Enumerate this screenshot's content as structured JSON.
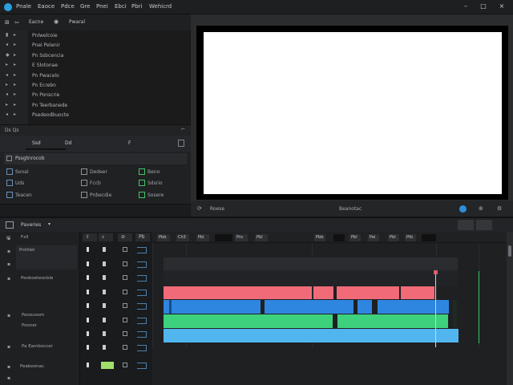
{
  "menu": [
    "Pnale",
    "Eaoce",
    "Pdce",
    "Gre",
    "Pnei",
    "Ebci",
    "Pbri",
    "Wehicrd"
  ],
  "window_controls": [
    "–",
    "□",
    "×"
  ],
  "media": {
    "header_back": "⊞",
    "header_arrow": "⇦",
    "header_label": "Eacne",
    "header_icon": "◉",
    "header_name": "Pwaral",
    "items": [
      {
        "text": "Pnlwelcoie"
      },
      {
        "text": "Pnei Pelenir"
      },
      {
        "text": "Pn Ssbcencia"
      },
      {
        "text": "E Slotonae"
      },
      {
        "text": "Pn Pwacelo"
      },
      {
        "text": "Pn Ecrebn"
      },
      {
        "text": "Pn Ponscrie"
      },
      {
        "text": "Pn Teerbanede"
      },
      {
        "text": "Psedeodbuocte"
      }
    ]
  },
  "tray": {
    "left": "Ds Qs",
    "right": "⌐"
  },
  "tabs": {
    "a": "Ssd",
    "b": "Dd",
    "c": "F"
  },
  "effects": {
    "title": "Pssgtnrocob",
    "items": [
      {
        "text": "Sonal"
      },
      {
        "text": "Dedeer"
      },
      {
        "text": "Beno"
      },
      {
        "text": "Uds"
      },
      {
        "text": "Fccb"
      },
      {
        "text": "Sdsrio"
      },
      {
        "text": "Teacen"
      },
      {
        "text": "Pnbecdie"
      },
      {
        "text": "Sosere"
      }
    ]
  },
  "preview": {
    "left_text": "Roese",
    "center_text": "Beanotac",
    "loop_icon": "⟳",
    "mark_in": "⊕",
    "settings": "⚙"
  },
  "timeline": {
    "toolbar_icon": "⊟",
    "toolbar_label": "Paveries",
    "toolbar_chevron": "▾",
    "ruler_buttons_left": [
      "Pbb",
      "Ch3",
      "Pbi",
      "",
      "Pro",
      "Pbl"
    ],
    "ruler_buttons_right": [
      "Pbb",
      "",
      "Pbl",
      "Pei",
      "Pbl",
      "Ptb",
      ""
    ],
    "track_names": [
      {
        "text": "Fxll"
      },
      {
        "text": "Pnhtlet"
      },
      {
        "text": "Peoboeteocble"
      },
      {
        "text": "Peoouosm"
      },
      {
        "text": "Pooner"
      },
      {
        "text": "Pa Eamboccer"
      },
      {
        "text": "Peabeonac"
      }
    ],
    "ctrl_headers": [
      "⇧",
      "⌕",
      "⊘",
      "Pb"
    ]
  },
  "colors": {
    "accent": "#2aa1e0",
    "clip_red": "#f06b77",
    "clip_blue": "#2f86e0",
    "clip_green": "#3dd17d",
    "clip_lightblue": "#52b6ee",
    "bg": "#1b1c1e"
  }
}
